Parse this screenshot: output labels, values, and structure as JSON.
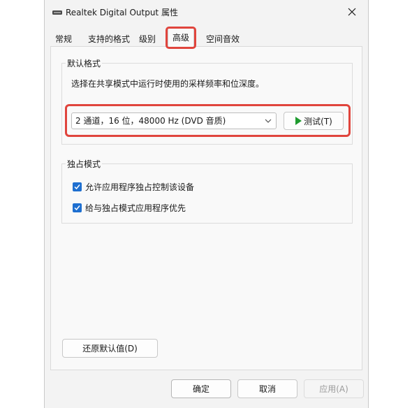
{
  "window": {
    "title": "Realtek Digital Output 属性",
    "icon": "speaker-device-icon"
  },
  "tabs": [
    {
      "label": "常规",
      "active": false
    },
    {
      "label": "支持的格式",
      "active": false
    },
    {
      "label": "级别",
      "active": false
    },
    {
      "label": "高级",
      "active": true
    },
    {
      "label": "空间音效",
      "active": false
    }
  ],
  "default_format": {
    "legend": "默认格式",
    "description": "选择在共享模式中运行时使用的采样频率和位深度。",
    "selected_value": "2 通道，16 位，48000 Hz (DVD 音质)",
    "test_button": "测试(T)"
  },
  "exclusive_mode": {
    "legend": "独占模式",
    "options": [
      {
        "label": "允许应用程序独占控制该设备",
        "checked": true
      },
      {
        "label": "给与独占模式应用程序优先",
        "checked": true
      }
    ]
  },
  "restore_button": "还原默认值(D)",
  "footer": {
    "ok": "确定",
    "cancel": "取消",
    "apply": "应用(A)",
    "apply_enabled": false
  },
  "colors": {
    "highlight": "#e0453d",
    "checkbox": "#1e6fd0",
    "play": "#1f9b2f"
  }
}
